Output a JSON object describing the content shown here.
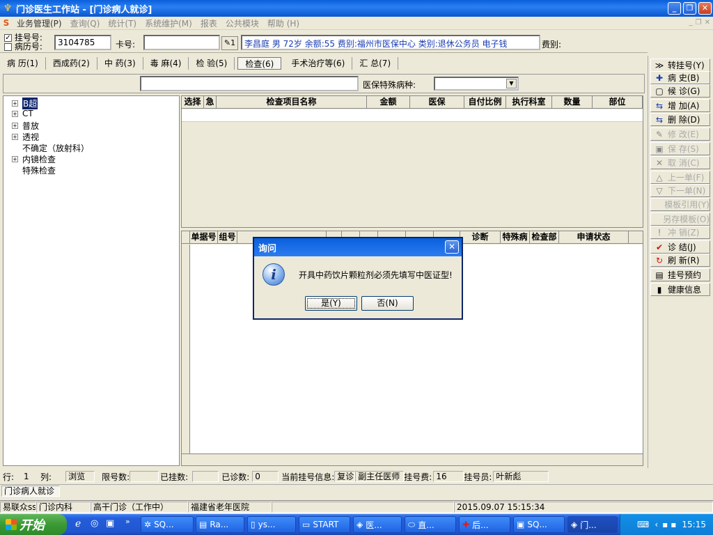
{
  "window": {
    "title": "门诊医生工作站 - [门诊病人就诊]"
  },
  "menu": [
    "业务管理(P)",
    "查询(Q)",
    "统计(T)",
    "系统维护(M)",
    "报表",
    "公共模块",
    "帮助 (H)"
  ],
  "patient": {
    "reg_no_label": "挂号号:",
    "record_no_label": "病历号:",
    "record_no_value": "3104785",
    "card_label": "卡号:",
    "card_value": "",
    "info": "李昌庭 男 72岁 余额:55 费别:福州市医保中心 类别:退休公务员 电子钱",
    "fee_label": "费别:"
  },
  "tabs": [
    "病 历(1)",
    "西成药(2)",
    "中 药(3)",
    "毒 麻(4)",
    "检 验(5)",
    "检查(6)",
    "手术治疗等(6)",
    "汇 总(7)"
  ],
  "filter": {
    "search_value": "",
    "special_label": "医保特殊病种:",
    "special_value": ""
  },
  "tree": [
    {
      "label": "B超",
      "expand": "+",
      "selected": true
    },
    {
      "label": "CT",
      "expand": "+"
    },
    {
      "label": "普放",
      "expand": "+"
    },
    {
      "label": "透视",
      "expand": "+"
    },
    {
      "label": "不确定（放射科）",
      "expand": ""
    },
    {
      "label": "内镜检查",
      "expand": "+"
    },
    {
      "label": "特殊检查",
      "expand": ""
    }
  ],
  "grid_top": {
    "columns": [
      "选择",
      "急",
      "检查项目名称",
      "金额",
      "医保",
      "自付比例",
      "执行科室",
      "数量",
      "部位"
    ]
  },
  "grid_bottom": {
    "columns": [
      "",
      "单据号",
      "组号",
      "",
      "",
      "",
      "",
      "",
      "",
      "",
      "诊断",
      "特殊病",
      "检查部",
      "申请状态"
    ]
  },
  "side_buttons": [
    {
      "label": "转挂号(Y)",
      "icon": "≫",
      "enabled": true
    },
    {
      "label": "病 史(B)",
      "icon": "✚",
      "enabled": true
    },
    {
      "label": "候 诊(G)",
      "icon": "▢",
      "enabled": true
    },
    {
      "label": "增 加(A)",
      "icon": "⇆",
      "enabled": true
    },
    {
      "label": "删 除(D)",
      "icon": "⇆",
      "enabled": true
    },
    {
      "label": "修 改(E)",
      "icon": "✎",
      "enabled": false
    },
    {
      "label": "保 存(S)",
      "icon": "▣",
      "enabled": false
    },
    {
      "label": "取 消(C)",
      "icon": "✕",
      "enabled": false
    },
    {
      "label": "上一单(F)",
      "icon": "△",
      "enabled": false
    },
    {
      "label": "下一单(N)",
      "icon": "▽",
      "enabled": false
    },
    {
      "label": "模板引用(Y)",
      "icon": "",
      "enabled": false
    },
    {
      "label": "另存模板(O)",
      "icon": "",
      "enabled": false
    },
    {
      "label": "冲 销(Z)",
      "icon": "!",
      "enabled": false
    },
    {
      "label": "诊 结(J)",
      "icon": "✔",
      "enabled": true
    },
    {
      "label": "刷 新(R)",
      "icon": "↻",
      "enabled": true
    },
    {
      "label": "挂号预约",
      "icon": "▤",
      "enabled": true
    },
    {
      "label": "健康信息",
      "icon": "▮",
      "enabled": true
    }
  ],
  "status": {
    "row_label": "行:",
    "row_value": "1",
    "col_label": "列:",
    "mode": "浏览",
    "limit_label": "限号数:",
    "limit_value": "",
    "registered_label": "已挂数:",
    "registered_value": "",
    "seen_label": "已诊数:",
    "seen_value": "0",
    "current_label": "当前挂号信息:",
    "current_type": "复诊",
    "current_doctor": "副主任医师",
    "fee_label": "挂号费:",
    "fee_value": "16",
    "clerk_label": "挂号员:",
    "clerk_value": "叶新彪",
    "window_tab": "门诊病人就诊",
    "user": "易联众ss",
    "dept": "门诊内科",
    "clinic": "高干门诊（工作中）",
    "hospital": "福建省老年医院",
    "datetime": "2015.09.07 15:15:34"
  },
  "dialog": {
    "title": "询问",
    "message": "开具中药饮片颗粒剂必须先填写中医证型!",
    "yes": "是(Y)",
    "no": "否(N)"
  },
  "taskbar": {
    "start": "开始",
    "items": [
      "SQ...",
      "Ra...",
      "ys...",
      "START",
      "医...",
      "直...",
      "后...",
      "SQ...",
      "门..."
    ],
    "clock": "15:15"
  }
}
